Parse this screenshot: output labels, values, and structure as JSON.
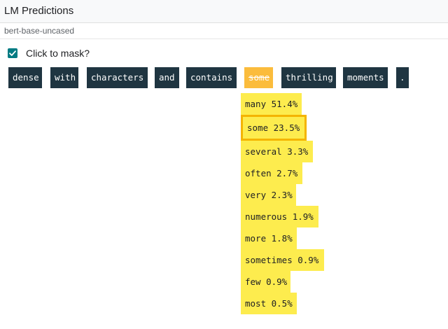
{
  "header": {
    "title": "LM Predictions"
  },
  "model": {
    "name": "bert-base-uncased"
  },
  "mask": {
    "label": "Click to mask?",
    "checked": true
  },
  "tokens": [
    "dense",
    "with",
    "characters",
    "and",
    "contains",
    "some",
    "thrilling",
    "moments",
    "."
  ],
  "masked_index": 5,
  "predictions": [
    {
      "text": "many 51.4%",
      "probability": 0.514
    },
    {
      "text": "some 23.5%",
      "probability": 0.235,
      "selected": true
    },
    {
      "text": "several 3.3%",
      "probability": 0.033
    },
    {
      "text": "often 2.7%",
      "probability": 0.027
    },
    {
      "text": "very 2.3%",
      "probability": 0.023
    },
    {
      "text": "numerous 1.9%",
      "probability": 0.019
    },
    {
      "text": "more 1.8%",
      "probability": 0.018
    },
    {
      "text": "sometimes 0.9%",
      "probability": 0.009
    },
    {
      "text": "few 0.9%",
      "probability": 0.009
    },
    {
      "text": "most 0.5%",
      "probability": 0.005
    }
  ],
  "colors": {
    "token_bg": "#1f3541",
    "masked_token_bg": "#fbbc3c",
    "prediction_bg": "#fdec4e",
    "selected_outline": "#f4b400",
    "checkbox": "#007b83"
  }
}
